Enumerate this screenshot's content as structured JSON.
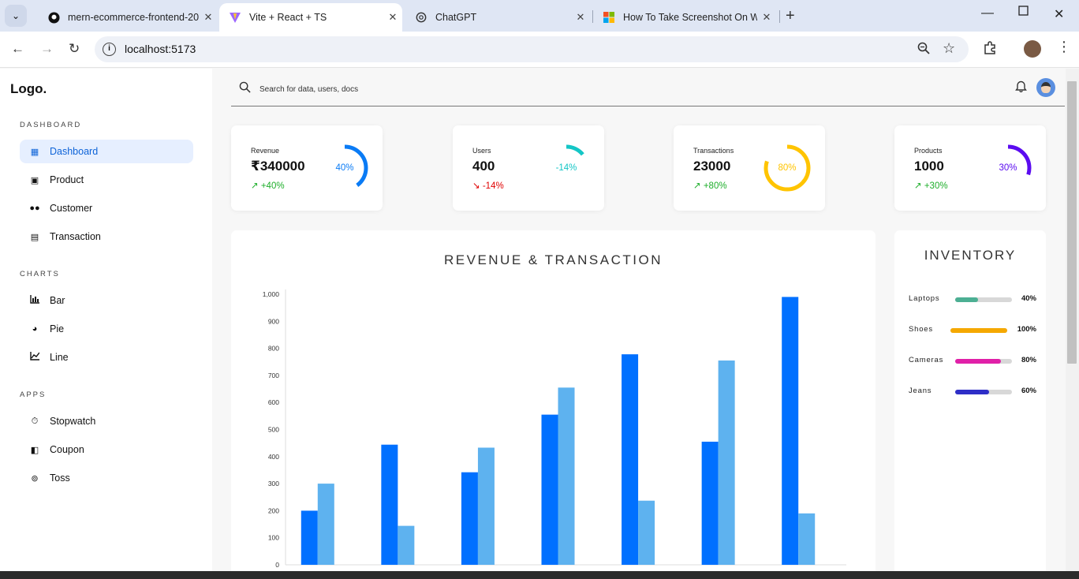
{
  "browser": {
    "tabs": [
      {
        "title": "mern-ecommerce-frontend-20",
        "favicon": "github-icon",
        "active": false
      },
      {
        "title": "Vite + React + TS",
        "favicon": "vite-icon",
        "active": true
      },
      {
        "title": "ChatGPT",
        "favicon": "openai-icon",
        "active": false
      },
      {
        "title": "How To Take Screenshot On Wi",
        "favicon": "microsoft-icon",
        "active": false
      }
    ],
    "url": "localhost:5173"
  },
  "sidebar": {
    "logo": "Logo.",
    "sections": [
      {
        "title": "DASHBOARD",
        "items": [
          {
            "label": "Dashboard",
            "icon": "grid-icon",
            "active": true
          },
          {
            "label": "Product",
            "icon": "bag-icon",
            "active": false
          },
          {
            "label": "Customer",
            "icon": "people-icon",
            "active": false
          },
          {
            "label": "Transaction",
            "icon": "document-icon",
            "active": false
          }
        ]
      },
      {
        "title": "CHARTS",
        "items": [
          {
            "label": "Bar",
            "icon": "bar-chart-icon",
            "active": false
          },
          {
            "label": "Pie",
            "icon": "pie-chart-icon",
            "active": false
          },
          {
            "label": "Line",
            "icon": "line-chart-icon",
            "active": false
          }
        ]
      },
      {
        "title": "APPS",
        "items": [
          {
            "label": "Stopwatch",
            "icon": "stopwatch-icon",
            "active": false
          },
          {
            "label": "Coupon",
            "icon": "ticket-icon",
            "active": false
          },
          {
            "label": "Toss",
            "icon": "coin-icon",
            "active": false
          }
        ]
      }
    ]
  },
  "header": {
    "search_placeholder": "Search for data, users, docs"
  },
  "widgets": [
    {
      "label": "Revenue",
      "value": "₹340000",
      "change": "+40%",
      "trend": "up",
      "percent": 40,
      "percent_label": "40%",
      "color": "#0a7bf5"
    },
    {
      "label": "Users",
      "value": "400",
      "change": "-14%",
      "trend": "down",
      "percent": 14,
      "percent_label": "-14%",
      "color": "#14c6c6"
    },
    {
      "label": "Transactions",
      "value": "23000",
      "change": "+80%",
      "trend": "up",
      "percent": 80,
      "percent_label": "80%",
      "color": "#ffc400"
    },
    {
      "label": "Products",
      "value": "1000",
      "change": "+30%",
      "trend": "up",
      "percent": 30,
      "percent_label": "30%",
      "color": "#5b0cf0"
    }
  ],
  "colors": {
    "up": "#1dae2a",
    "down": "#e00000",
    "series1": "#0070ff",
    "series2": "#5eb2ef"
  },
  "chart_data": {
    "type": "bar",
    "title": "REVENUE & TRANSACTION",
    "categories": [
      "",
      "",
      "",
      "",
      "",
      "",
      ""
    ],
    "series": [
      {
        "values": [
          200,
          444,
          342,
          555,
          778,
          455,
          990
        ]
      },
      {
        "values": [
          300,
          144,
          433,
          655,
          237,
          755,
          190
        ]
      }
    ],
    "ylim": [
      0,
      1000
    ],
    "yticks": [
      "0",
      "100",
      "200",
      "300",
      "400",
      "500",
      "600",
      "700",
      "800",
      "900",
      "1,000"
    ],
    "grid": false
  },
  "inventory": {
    "title": "INVENTORY",
    "items": [
      {
        "name": "Laptops",
        "percent": 40,
        "label": "40%",
        "color": "#4caf93"
      },
      {
        "name": "Shoes",
        "percent": 100,
        "label": "100%",
        "color": "#f5a800"
      },
      {
        "name": "Cameras",
        "percent": 80,
        "label": "80%",
        "color": "#e020a8"
      },
      {
        "name": "Jeans",
        "percent": 60,
        "label": "60%",
        "color": "#2e2ec7"
      }
    ]
  }
}
